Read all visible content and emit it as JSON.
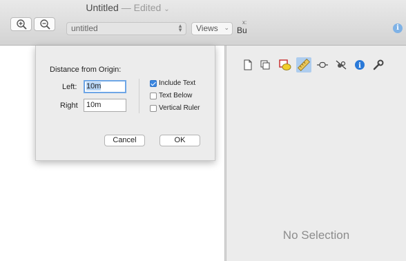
{
  "window": {
    "title": "Untitled",
    "status": "— Edited",
    "title_chevron": "⌄"
  },
  "toolbar": {
    "zoom_in_icon": "magnifier-plus",
    "zoom_out_icon": "magnifier-minus",
    "document_select": {
      "value": "untitled"
    },
    "views_select": {
      "value": "Views",
      "chevron": "⌄"
    },
    "coordinates": {
      "x_label": "x:",
      "y_label": "Bu"
    },
    "info_icon": "i"
  },
  "inspector": {
    "icons": [
      "page-icon",
      "layers-icon",
      "shape-style-icon",
      "ruler-icon",
      "connector-icon",
      "linked-icon",
      "info-icon",
      "wrench-icon"
    ],
    "selected_icon": "ruler-icon",
    "empty_label": "No Selection",
    "info_glyph": "i"
  },
  "dialog": {
    "heading": "Distance from Origin:",
    "left_label": "Left:",
    "left_value": "10m",
    "right_label": "Right",
    "right_value": "10m",
    "options": [
      {
        "label": "Include Text",
        "checked": true
      },
      {
        "label": "Text Below",
        "checked": false
      },
      {
        "label": "Vertical Ruler",
        "checked": false
      }
    ],
    "cancel_label": "Cancel",
    "ok_label": "OK"
  },
  "colors": {
    "accent": "#3b86e0",
    "selection": "#aecdee",
    "focus_ring": "#6ea6e6"
  }
}
